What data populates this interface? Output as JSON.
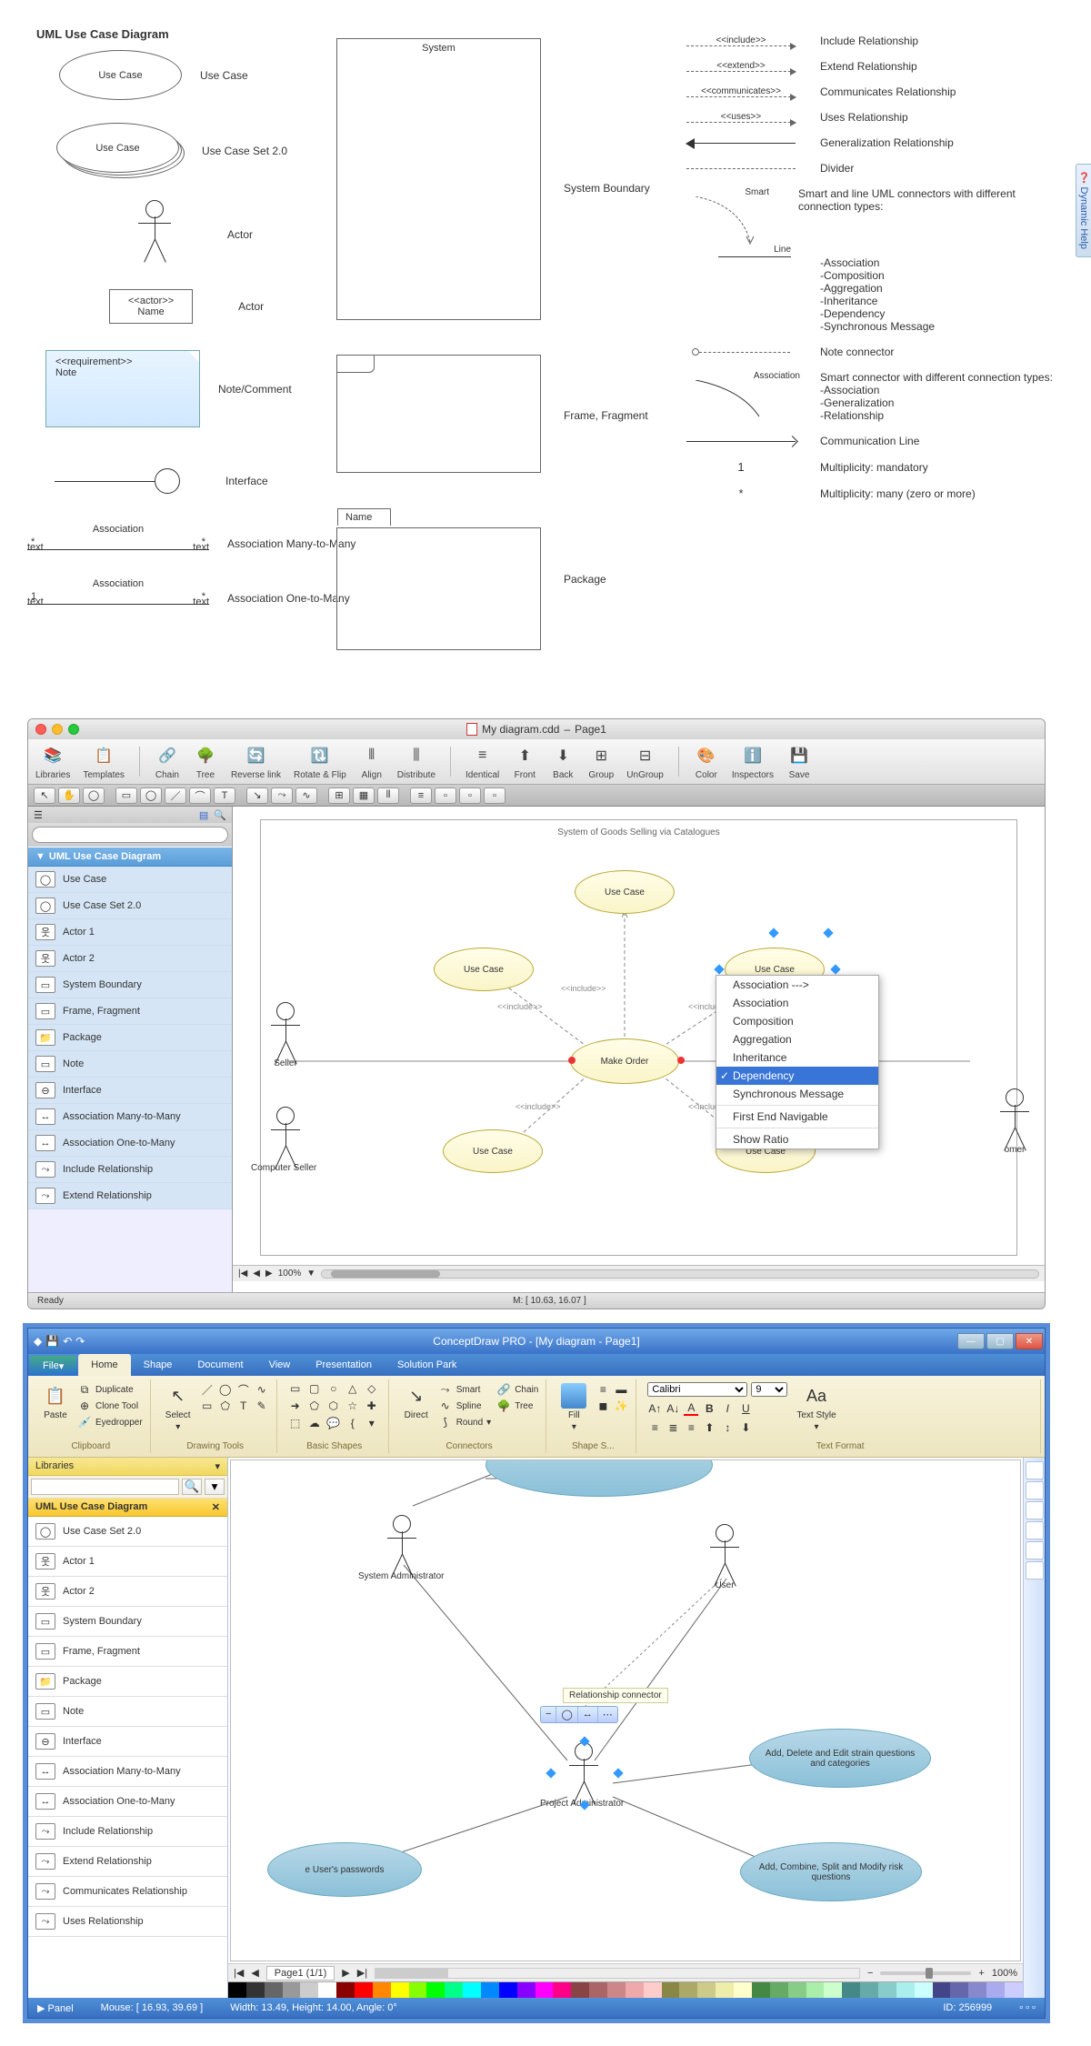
{
  "reference": {
    "title": "UML Use Case Diagram",
    "shapes": {
      "use_case": "Use Case",
      "use_case_set": "Use Case",
      "use_case_set_label": "Use Case Set 2.0",
      "actor_label": "Actor",
      "actor_box_stereo": "<<actor>>",
      "actor_box_name": "Name",
      "actor_box_label": "Actor",
      "note_stereo": "<<requirement>>",
      "note_text": "Note",
      "note_label": "Note/Comment",
      "interface_label": "Interface",
      "assoc_mm_top": "Association",
      "assoc_mm_left": "*",
      "assoc_mm_right": "*",
      "assoc_mm_text": "text",
      "assoc_mm_label": "Association Many-to-Many",
      "assoc_om_left": "1",
      "assoc_om_right": "*",
      "assoc_om_label": "Association One-to-Many",
      "system_title": "System",
      "system_label": "System Boundary",
      "frame_label": "Frame, Fragment",
      "package_tab": "Name",
      "package_label": "Package"
    },
    "connectors": {
      "include_stereo": "<<include>>",
      "include_label": "Include Relationship",
      "extend_stereo": "<<extend>>",
      "extend_label": "Extend Relationship",
      "comm_stereo": "<<communicates>>",
      "comm_label": "Communicates Relationship",
      "uses_stereo": "<<uses>>",
      "uses_label": "Uses Relationship",
      "gen_label": "Generalization Relationship",
      "divider_label": "Divider",
      "smart_label": "Smart",
      "smart_desc": "Smart and line UML connectors with different connection types:",
      "smart_types": "-Association\n-Composition\n-Aggregation\n-Inheritance\n-Dependency\n-Synchronous Message",
      "line_label": "Line",
      "note_conn_label": "Note connector",
      "assoc_conn_label": "Association",
      "assoc_desc": "Smart connector with different connection types:\n-Association\n-Generalization\n-Relationship",
      "commline_label": "Communication Line",
      "mult1": "1",
      "mult1_label": "Multiplicity: mandatory",
      "multn": "*",
      "multn_label": "Multiplicity: many (zero or more)"
    }
  },
  "mac": {
    "title_doc": "My diagram.cdd",
    "title_page": "Page1",
    "toolbar": [
      "Libraries",
      "Templates",
      "Chain",
      "Tree",
      "Reverse link",
      "Rotate & Flip",
      "Align",
      "Distribute",
      "Identical",
      "Front",
      "Back",
      "Group",
      "UnGroup",
      "Color",
      "Inspectors",
      "Save"
    ],
    "sidebar_header": "UML Use Case Diagram",
    "sidebar_items": [
      "Use Case",
      "Use Case Set 2.0",
      "Actor 1",
      "Actor 2",
      "System Boundary",
      "Frame, Fragment",
      "Package",
      "Note",
      "Interface",
      "Association Many-to-Many",
      "Association One-to-Many",
      "Include Relationship",
      "Extend Relationship"
    ],
    "canvas_title": "System of Goods Selling via Catalogues",
    "use_cases": {
      "top": "Use Case",
      "left": "Use Case",
      "right": "Use Case",
      "center": "Make Order",
      "bl": "Use Case",
      "br": "Use Case"
    },
    "actors": {
      "seller": "Seller",
      "computer_seller": "Computer Seller",
      "customer": "omer"
    },
    "include_text": "<<include>>",
    "context_menu": [
      "Association --->",
      "Association",
      "Composition",
      "Aggregation",
      "Inheritance",
      "Dependency",
      "Synchronous Message",
      "First End Navigable",
      "Show Ratio"
    ],
    "context_selected": "Dependency",
    "zoom": "100%",
    "status_ready": "Ready",
    "status_mouse": "M: [ 10.63, 16.07 ]"
  },
  "win": {
    "app_title": "ConceptDraw PRO - [My diagram - Page1]",
    "file_menu": "File",
    "tabs": [
      "Home",
      "Shape",
      "Document",
      "View",
      "Presentation",
      "Solution Park"
    ],
    "active_tab": "Home",
    "ribbon": {
      "clipboard": {
        "label": "Clipboard",
        "paste": "Paste",
        "duplicate": "Duplicate",
        "clone": "Clone Tool",
        "eyedropper": "Eyedropper"
      },
      "drawing": {
        "label": "Drawing Tools",
        "select": "Select"
      },
      "shapes": {
        "label": "Basic Shapes"
      },
      "connectors": {
        "label": "Connectors",
        "direct": "Direct",
        "smart": "Smart",
        "spline": "Spline",
        "round": "Round",
        "chain": "Chain",
        "tree": "Tree"
      },
      "fill": {
        "label": "Shape S...",
        "fill": "Fill"
      },
      "text": {
        "label": "Text Format",
        "font": "Calibri",
        "size": "9",
        "style": "Text Style"
      }
    },
    "sidebar_header": "Libraries",
    "sidebar_category": "UML Use Case Diagram",
    "sidebar_items": [
      "Use Case Set 2.0",
      "Actor 1",
      "Actor 2",
      "System Boundary",
      "Frame, Fragment",
      "Package",
      "Note",
      "Interface",
      "Association Many-to-Many",
      "Association One-to-Many",
      "Include Relationship",
      "Extend Relationship",
      "Communicates Relationship",
      "Uses Relationship"
    ],
    "canvas": {
      "sysadmin": "System Administrator",
      "user": "User",
      "projadmin": "Project Administrator",
      "tooltip": "Relationship connector",
      "uc_passwords": "e User's passwords",
      "uc_strain": "Add, Delete and Edit strain questions and categories",
      "uc_risk": "Add, Combine, Split and Modify risk questions"
    },
    "dynamic_help": "Dynamic Help",
    "page_indicator": "Page1 (1/1)",
    "status": {
      "panel": "Panel",
      "mouse": "Mouse: [ 16.93, 39.69 ]",
      "width": "Width: 13.49,",
      "height": "Height: 14.00,",
      "angle": "Angle: 0°",
      "id": "ID: 256999",
      "zoom": "100%"
    }
  }
}
